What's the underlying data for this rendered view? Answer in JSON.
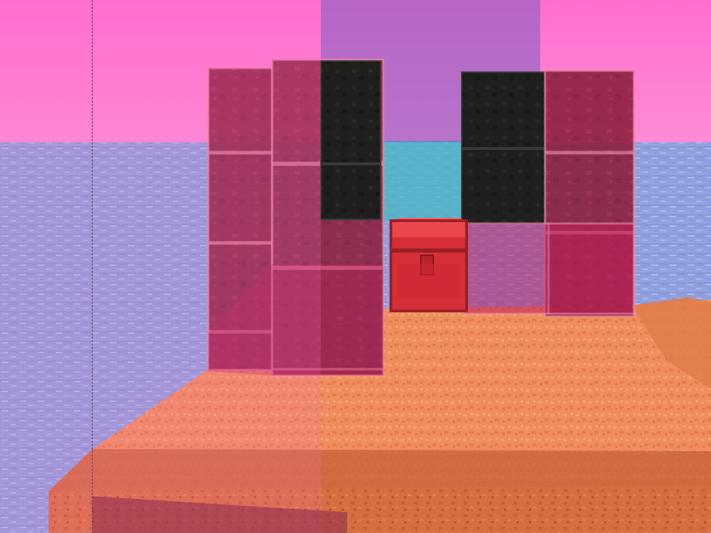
{
  "scene": {
    "sky_color": "#ff6ed0",
    "sky_horizon_color": "#ff8fd6",
    "water_color": "#8fa0dc",
    "water_highlight": "#c7d2f2",
    "water_shadow": "#6f86c8",
    "lagoon_color": "#3fb6c0",
    "floor_color": "#ef8c5b",
    "floor_side_color": "#d76b3e",
    "floor_dark_color": "#b95534",
    "glass_tint": "#c21f5a",
    "glass_edge": "#e98aa8",
    "dark_block_color": "#1e1e1c",
    "chest_color": "#d62f37",
    "chest_dark": "#9c1f28",
    "chest_light": "#ff5a5e",
    "purple_pane_color": "#7b5fc0"
  },
  "objects": [
    {
      "name": "glass-pillar-left",
      "material": "stained-glass-magenta"
    },
    {
      "name": "dark-pillar-left",
      "material": "black-concrete"
    },
    {
      "name": "dark-pillar-right",
      "material": "black-concrete"
    },
    {
      "name": "glass-pillar-right",
      "material": "stained-glass-magenta"
    },
    {
      "name": "red-chest",
      "material": "chest"
    },
    {
      "name": "terracotta-platform",
      "material": "terracotta"
    },
    {
      "name": "near-glass-pane",
      "material": "stained-glass-magenta"
    }
  ]
}
